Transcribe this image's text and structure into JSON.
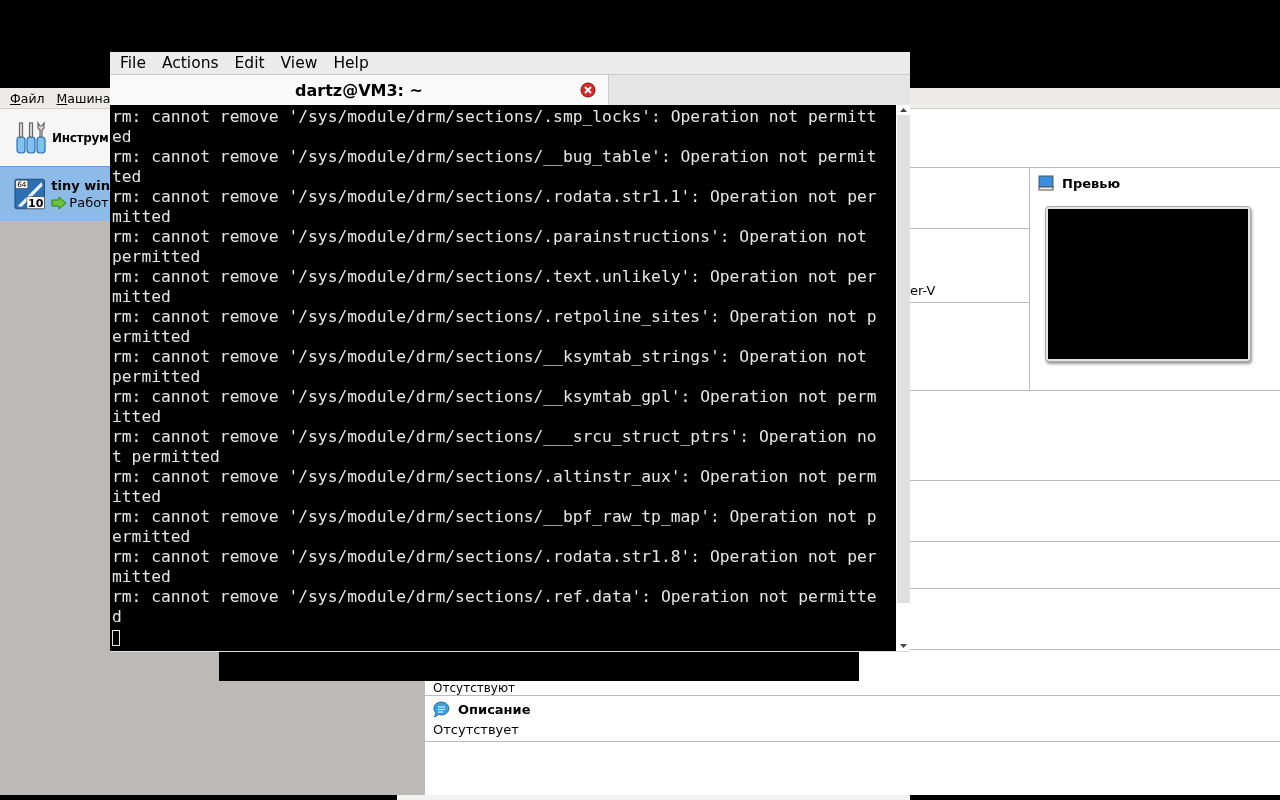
{
  "virtualbox": {
    "menu": [
      {
        "label": "Файл"
      },
      {
        "label": "Машина"
      }
    ],
    "tools_item": {
      "label": "Инструм"
    },
    "vm_item": {
      "name": "tiny win",
      "state": "Работ",
      "selected": true,
      "badge_bits": "64",
      "badge_version": "10"
    },
    "details": {
      "fragment": "er-V",
      "preview_title": "Превью",
      "usb_value": "Отсутствуют",
      "description_title": "Описание",
      "description_value": "Отсутствует"
    }
  },
  "terminal": {
    "menu": [
      "File",
      "Actions",
      "Edit",
      "View",
      "Help"
    ],
    "tab_title": "dartz@VM3: ~",
    "lines": [
      "rm: cannot remove '/sys/module/drm/sections/.smp_locks': Operation not permitt",
      "ed",
      "rm: cannot remove '/sys/module/drm/sections/__bug_table': Operation not permit",
      "ted",
      "rm: cannot remove '/sys/module/drm/sections/.rodata.str1.1': Operation not per",
      "mitted",
      "rm: cannot remove '/sys/module/drm/sections/.parainstructions': Operation not",
      "permitted",
      "rm: cannot remove '/sys/module/drm/sections/.text.unlikely': Operation not per",
      "mitted",
      "rm: cannot remove '/sys/module/drm/sections/.retpoline_sites': Operation not p",
      "ermitted",
      "rm: cannot remove '/sys/module/drm/sections/__ksymtab_strings': Operation not",
      "permitted",
      "rm: cannot remove '/sys/module/drm/sections/__ksymtab_gpl': Operation not perm",
      "itted",
      "rm: cannot remove '/sys/module/drm/sections/___srcu_struct_ptrs': Operation no",
      "t permitted",
      "rm: cannot remove '/sys/module/drm/sections/.altinstr_aux': Operation not perm",
      "itted",
      "rm: cannot remove '/sys/module/drm/sections/__bpf_raw_tp_map': Operation not p",
      "ermitted",
      "rm: cannot remove '/sys/module/drm/sections/.rodata.str1.8': Operation not per",
      "mitted",
      "rm: cannot remove '/sys/module/drm/sections/.ref.data': Operation not permitte",
      "d"
    ]
  }
}
